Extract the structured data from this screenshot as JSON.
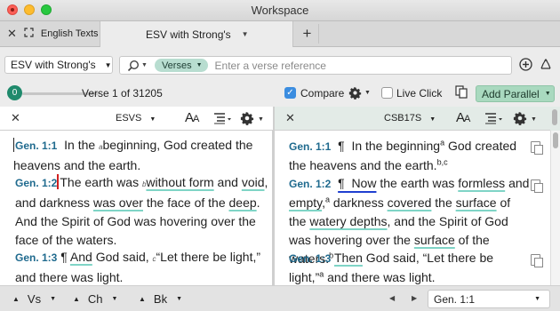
{
  "window": {
    "title": "Workspace"
  },
  "tabs": [
    {
      "label": "English Texts"
    },
    {
      "label": "ESV with Strong's"
    }
  ],
  "search": {
    "translation": "ESV with Strong's",
    "scope": "Verses",
    "placeholder": "Enter a verse reference"
  },
  "progress": {
    "bubble": "0",
    "verse_label": "Verse 1 of 31205",
    "fraction": 0.0
  },
  "compare": {
    "label": "Compare",
    "checked": true
  },
  "live_click": {
    "label": "Live Click",
    "checked": false
  },
  "add_parallel": {
    "label": "Add Parallel"
  },
  "panes": {
    "left": {
      "translation": "ESVS",
      "font_label": "AA",
      "verses": [
        {
          "ref": "Gen. 1:1",
          "text": "In the beginning, God created the heavens and the earth."
        },
        {
          "ref": "Gen. 1:2",
          "text": "The earth was without form and void, and darkness was over the face of the deep. And the Spirit of God was hovering over the face of the waters."
        },
        {
          "ref": "Gen. 1:3",
          "text": "¶ And God said, “Let there be light,” and there was light."
        }
      ]
    },
    "right": {
      "translation": "CSB17S",
      "font_label": "AA",
      "verses": [
        {
          "ref": "Gen. 1:1",
          "text": "¶ In the beginning God created the heavens and the earth."
        },
        {
          "ref": "Gen. 1:2",
          "text": "¶ Now the earth was formless and empty, darkness covered the surface of the watery depths, and the Spirit of God was hovering over the surface of the waters."
        },
        {
          "ref": "Gen. 1:3",
          "text": "Then God said, “Let there be light,” and there was light."
        }
      ]
    }
  },
  "bottom_bar": {
    "vs": "Vs",
    "ch": "Ch",
    "bk": "Bk",
    "reference": "Gen. 1:1"
  },
  "colors": {
    "accent_green": "#1f8a6c",
    "pill": "#b8ddd0",
    "verse_ref": "#1f6a8e",
    "highlight": "#7fd4c6",
    "add_parallel_bg": "#a9d9bf"
  },
  "icons": [
    "close-icon",
    "expand-icon",
    "search-icon",
    "plus-circle-icon",
    "recycle-icon",
    "gear-icon",
    "copy-icon",
    "font-size-icon",
    "list-icon",
    "note-icon"
  ]
}
